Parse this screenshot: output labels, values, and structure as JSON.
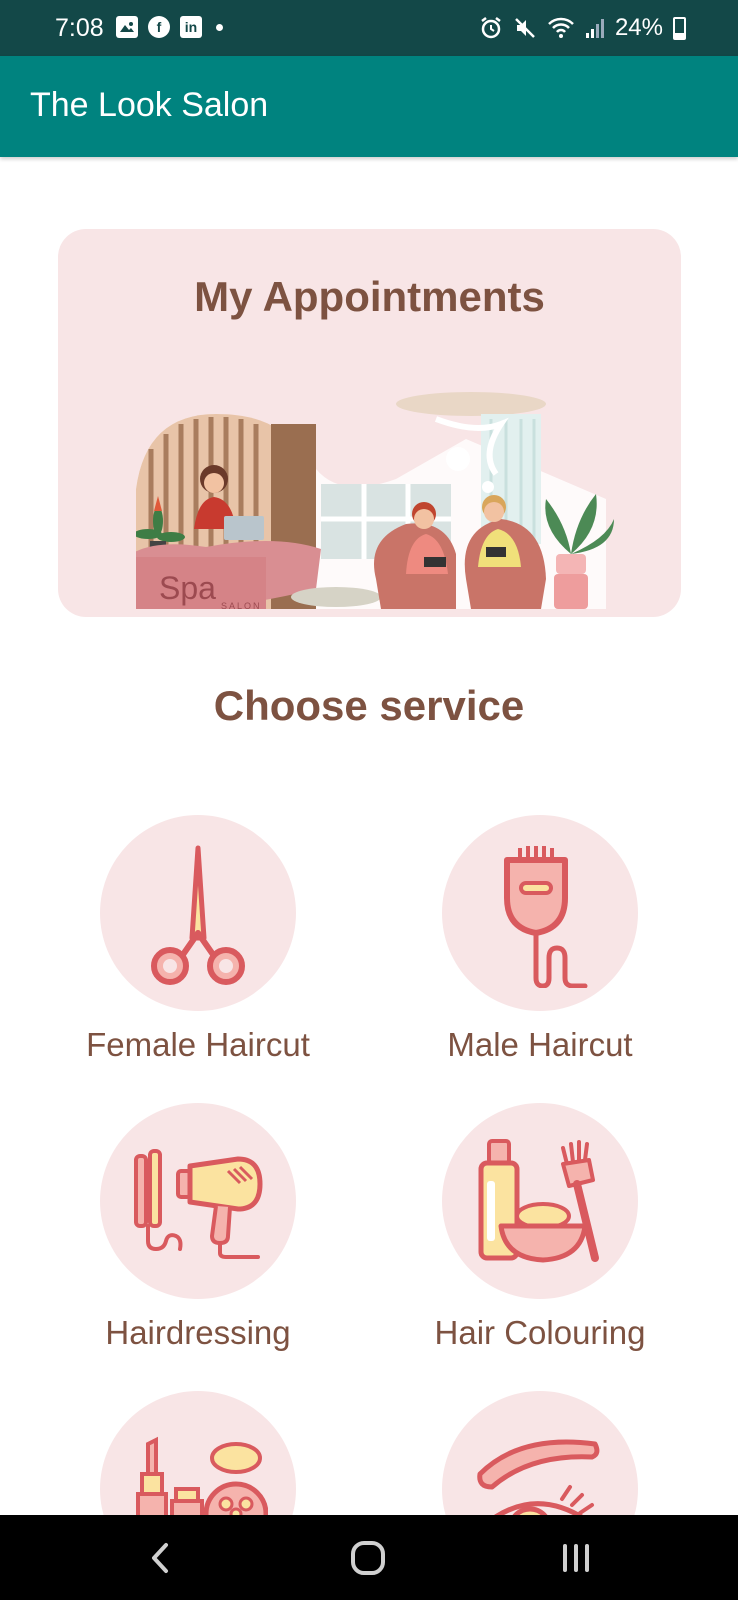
{
  "status_bar": {
    "time": "7:08",
    "battery": "24%",
    "notification_icons": [
      "gallery-icon",
      "facebook-icon",
      "linkedin-icon"
    ],
    "system_icons": [
      "alarm-icon",
      "mute-icon",
      "wifi-icon",
      "signal-icon",
      "battery-icon"
    ]
  },
  "app_bar": {
    "title": "The Look Salon"
  },
  "appointments": {
    "title": "My Appointments",
    "illustration_text": "Spa",
    "illustration_subtext": "SALON"
  },
  "services": {
    "heading": "Choose service",
    "items": [
      {
        "label": "Female Haircut",
        "icon": "scissors-icon"
      },
      {
        "label": "Male Haircut",
        "icon": "trimmer-icon"
      },
      {
        "label": "Hairdressing",
        "icon": "hairdryer-icon"
      },
      {
        "label": "Hair Colouring",
        "icon": "hair-dye-icon"
      },
      {
        "label": "",
        "icon": "makeup-icon"
      },
      {
        "label": "",
        "icon": "eyebrow-icon"
      }
    ]
  },
  "colors": {
    "status_bar": "#134848",
    "app_bar": "#00837f",
    "card_bg": "#f8e5e6",
    "heading_text": "#7d5241",
    "icon_stroke": "#d95a5e",
    "icon_fill_pink": "#f5b3ad",
    "icon_fill_yellow": "#fbe3a0"
  },
  "nav_bar": {
    "buttons": [
      "back",
      "home",
      "recents"
    ]
  }
}
